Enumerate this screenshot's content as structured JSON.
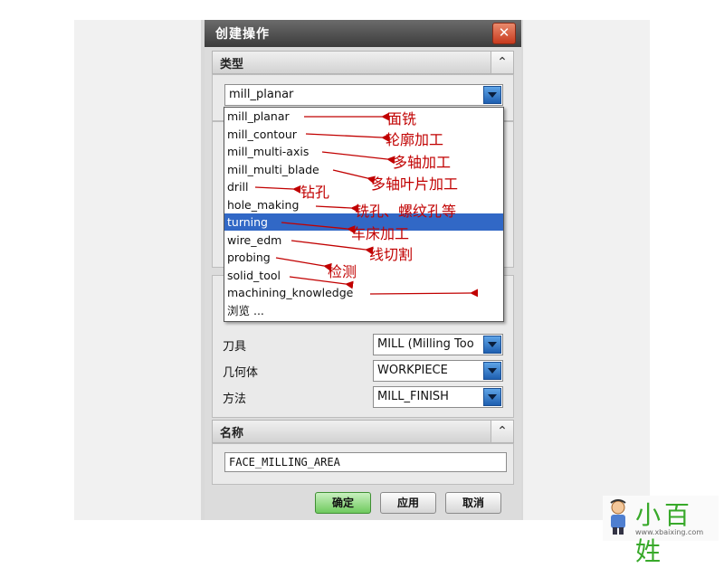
{
  "dialog": {
    "title": "创建操作",
    "close_glyph": "✕"
  },
  "type_section": {
    "header": "类型",
    "collapse_glyph": "⌃",
    "selected": "mill_planar"
  },
  "dropdown": {
    "options": [
      "mill_planar",
      "mill_contour",
      "mill_multi-axis",
      "mill_multi_blade",
      "drill",
      "hole_making",
      "turning",
      "wire_edm",
      "probing",
      "solid_tool",
      "machining_knowledge",
      "浏览 ..."
    ],
    "selected_index": 6
  },
  "location": {
    "rows": [
      {
        "label": "刀具",
        "value": "MILL (Milling Too"
      },
      {
        "label": "几何体",
        "value": "WORKPIECE"
      },
      {
        "label": "方法",
        "value": "MILL_FINISH"
      }
    ]
  },
  "name_section": {
    "header": "名称",
    "collapse_glyph": "⌃",
    "value": "FACE_MILLING_AREA"
  },
  "buttons": {
    "ok": "确定",
    "apply": "应用",
    "cancel": "取消"
  },
  "annotations": [
    "面铣",
    "轮廓加工",
    "多轴加工",
    "多轴叶片加工",
    "钻孔",
    "铣孔、螺纹孔等",
    "车床加工",
    "线切割",
    "检测"
  ],
  "watermark": {
    "brand": "小百姓",
    "url": "www.xbaixing.com"
  },
  "colors": {
    "highlight": "#3168c6",
    "annotation": "#c10000",
    "ok_button": "#6fca5e"
  }
}
